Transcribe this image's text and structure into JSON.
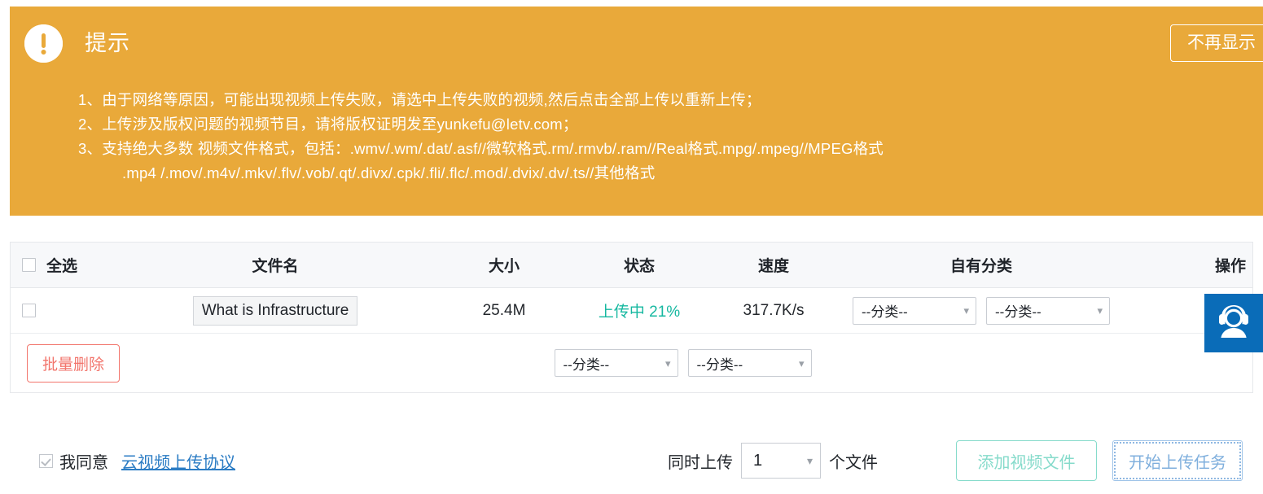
{
  "notice": {
    "icon": "exclamation-circle-icon",
    "title": "提示",
    "dismiss_label": "不再显示",
    "bg_color": "#e9a93a",
    "lines": [
      {
        "main": "1、由于网络等原因，可能出现视频上传失败，请选中上传失败的视频,然后点击全部上传以重新上传；",
        "cont": ""
      },
      {
        "main": "2、上传涉及版权问题的视频节目，请将版权证明发至yunkefu@letv.com；",
        "cont": ""
      },
      {
        "main": "3、支持绝大多数 视频文件格式，包括：.wmv/.wm/.dat/.asf//微软格式.rm/.rmvb/.ram//Real格式.mpg/.mpeg//MPEG格式",
        "cont": ".mp4 /.mov/.m4v/.mkv/.flv/.vob/.qt/.divx/.cpk/.fli/.flc/.mod/.dvix/.dv/.ts//其他格式"
      }
    ]
  },
  "table": {
    "headers": {
      "select_all": "全选",
      "filename": "文件名",
      "size": "大小",
      "status": "状态",
      "speed": "速度",
      "category": "自有分类",
      "action": "操作"
    },
    "rows": [
      {
        "checked": false,
        "filename": "What is Infrastructure",
        "size": "25.4M",
        "status": "上传中 21%",
        "status_color": "#16b8a0",
        "speed": "317.7K/s",
        "category_1": "--分类--",
        "category_2": "--分类--"
      }
    ],
    "footer": {
      "batch_delete_label": "批量删除",
      "batch_delete_color": "#f2756c",
      "category_1": "--分类--",
      "category_2": "--分类--"
    }
  },
  "bottom": {
    "agree_checked": true,
    "agree_label": "我同意",
    "agreement_link": "云视频上传协议",
    "concurrent_prefix": "同时上传",
    "concurrent_value": "1",
    "concurrent_suffix": "个文件",
    "add_files_label": "添加视频文件",
    "add_files_color": "#86dbcb",
    "start_upload_label": "开始上传任务",
    "start_upload_color": "#7fafdd"
  },
  "service_widget": {
    "icon": "headset-support-icon",
    "color": "#0a6cb8"
  }
}
